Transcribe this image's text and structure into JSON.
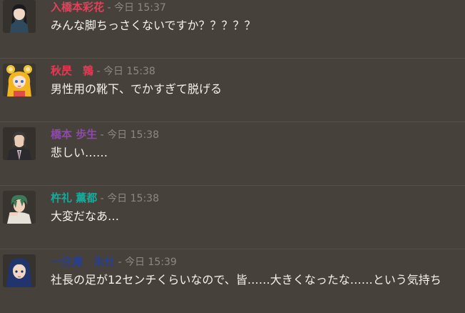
{
  "messages": [
    {
      "name": "入橋本彩花",
      "separator": " - ",
      "timestamp": "今日 15:37",
      "text": "みんな脚ちっさくないですか？？？？？",
      "name_color": "#e0425c",
      "avatar": "avatar-dark-haired-girl"
    },
    {
      "name": "秋昃　鶉",
      "separator": " - ",
      "timestamp": "今日 15:38",
      "text": "男性用の靴下、でかすぎて脱げる",
      "name_color": "#e03c55",
      "avatar": "avatar-blonde-bear-ears"
    },
    {
      "name": "橋本 歩生",
      "separator": " - ",
      "timestamp": "今日 15:38",
      "text": "悲しい……",
      "name_color": "#8e4aa8",
      "avatar": "avatar-suited-man"
    },
    {
      "name": "杵礼 薫都",
      "separator": " - ",
      "timestamp": "今日 15:38",
      "text": "大変だなあ…",
      "name_color": "#1aa89a",
      "avatar": "avatar-green-haired-man"
    },
    {
      "name": "一住連　朱杜",
      "separator": " - ",
      "timestamp": "今日 15:39",
      "text": "社長の足が12センチくらいなので、皆……大きくなったな……という気持ち",
      "name_color": "#2a3f8c",
      "avatar": "avatar-blue-haired-woman"
    }
  ]
}
